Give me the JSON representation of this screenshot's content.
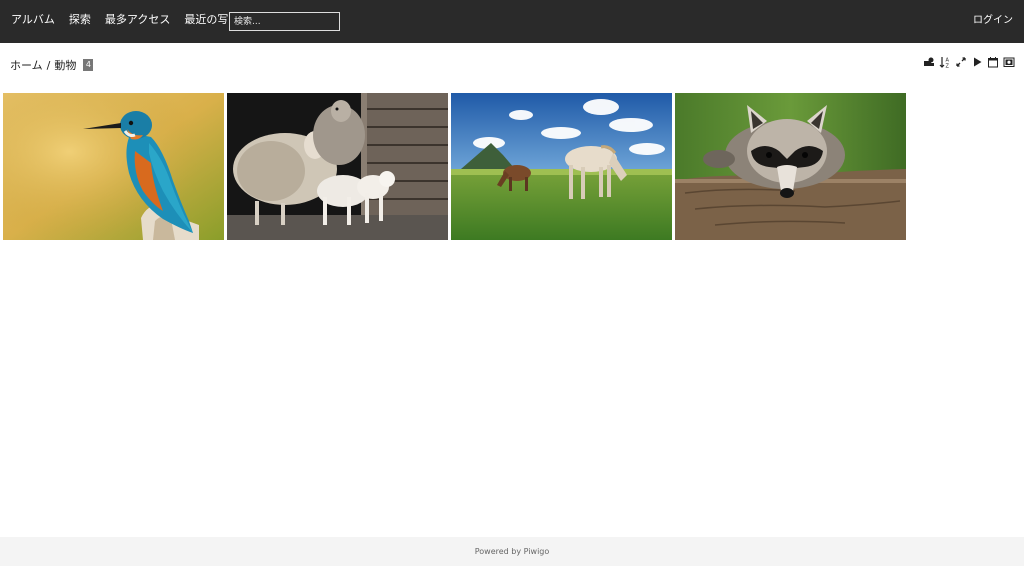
{
  "nav": {
    "links": [
      "アルバム",
      "探索",
      "最多アクセス",
      "最近の写真"
    ],
    "search_placeholder": "検索...",
    "login": "ログイン"
  },
  "breadcrumb": {
    "home": "ホーム",
    "separator": "/",
    "current": "動物",
    "count": "4"
  },
  "toolbar": {
    "icons": [
      "group-by-icon",
      "sort-order-icon",
      "size-toggle-icon",
      "slideshow-play-icon",
      "calendar-icon",
      "photo-info-icon"
    ]
  },
  "thumbnails": [
    {
      "subject": "kingfisher-bird"
    },
    {
      "subject": "sheep-and-lambs"
    },
    {
      "subject": "horses-on-meadow"
    },
    {
      "subject": "raccoon-on-log"
    }
  ],
  "footer": {
    "powered_by": "Powered by",
    "platform": "Piwigo"
  },
  "colors": {
    "navbar_bg": "#2a2a2a",
    "nav_text": "#ffffff",
    "footer_bg": "#f4f4f4",
    "badge_bg": "#777777"
  }
}
